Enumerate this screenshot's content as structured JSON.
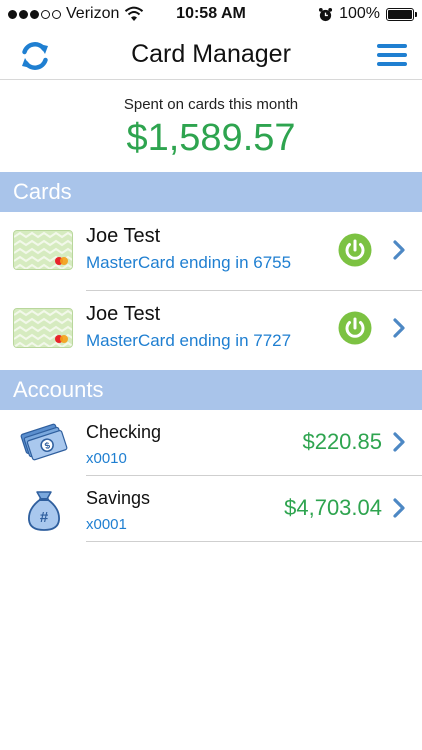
{
  "status_bar": {
    "carrier": "Verizon",
    "time": "10:58 AM",
    "battery": "100%",
    "signal_bars_filled": 3,
    "signal_bars_total": 5
  },
  "nav": {
    "title": "Card Manager",
    "refresh_icon": "refresh-icon",
    "menu_icon": "hamburger-menu-icon"
  },
  "summary": {
    "label": "Spent on cards this month",
    "amount": "$1,589.57"
  },
  "cards_section": {
    "title": "Cards",
    "items": [
      {
        "name": "Joe Test",
        "description": "MasterCard ending in 6755",
        "active": true
      },
      {
        "name": "Joe Test",
        "description": "MasterCard ending in 7727",
        "active": true
      }
    ]
  },
  "accounts_section": {
    "title": "Accounts",
    "items": [
      {
        "name": "Checking",
        "number": "x0010",
        "balance": "$220.85",
        "icon": "money-bills-icon"
      },
      {
        "name": "Savings",
        "number": "x0001",
        "balance": "$4,703.04",
        "icon": "money-bag-icon"
      }
    ]
  },
  "colors": {
    "accent_blue": "#1f7fd1",
    "section_header": "#a9c4ea",
    "money_green": "#2ea44f",
    "power_green": "#7cc242"
  }
}
